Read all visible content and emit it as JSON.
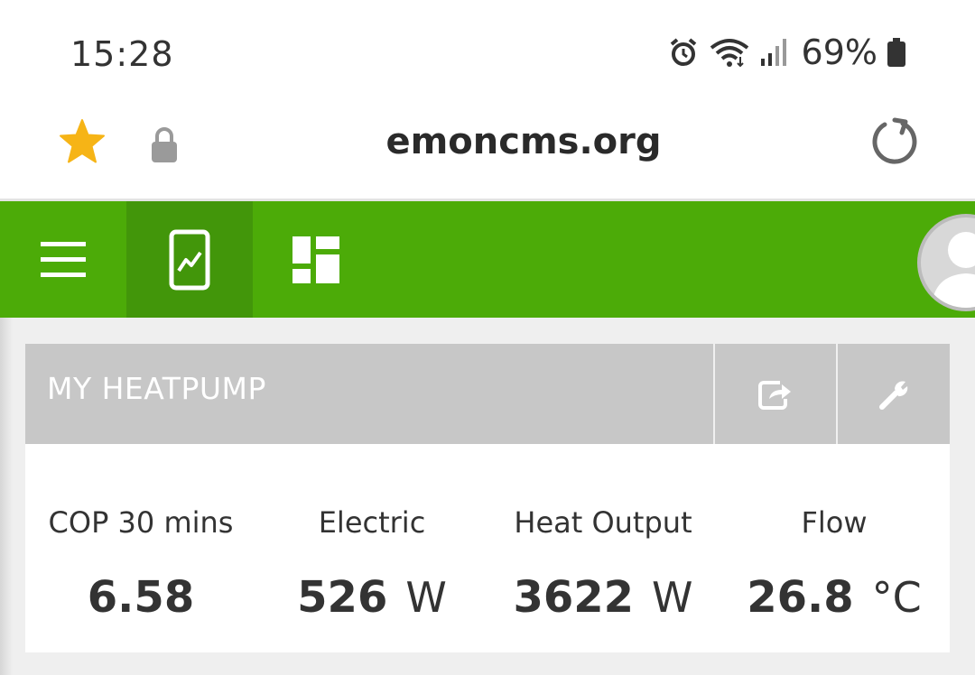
{
  "status_bar": {
    "time": "15:28",
    "battery_percent": "69%",
    "icons": [
      "alarm-icon",
      "wifi-icon",
      "signal-icon",
      "battery-icon"
    ]
  },
  "browser": {
    "url": "emoncms.org",
    "icons": [
      "star-icon",
      "lock-icon",
      "reload-icon"
    ]
  },
  "app_nav": {
    "icons": [
      "menu-icon",
      "app-icon",
      "dashboard-icon",
      "user-avatar-icon"
    ],
    "active": "app-icon",
    "color": "#4cab08"
  },
  "panel": {
    "title": "MY HEATPUMP",
    "header_icons": [
      "share-icon",
      "wrench-icon"
    ],
    "metrics": [
      {
        "label": "COP 30 mins",
        "value": "6.58",
        "unit": ""
      },
      {
        "label": "Electric",
        "value": "526",
        "unit": "W"
      },
      {
        "label": "Heat Output",
        "value": "3622",
        "unit": "W"
      },
      {
        "label": "Flow",
        "value": "26.8",
        "unit": "°C"
      }
    ]
  }
}
